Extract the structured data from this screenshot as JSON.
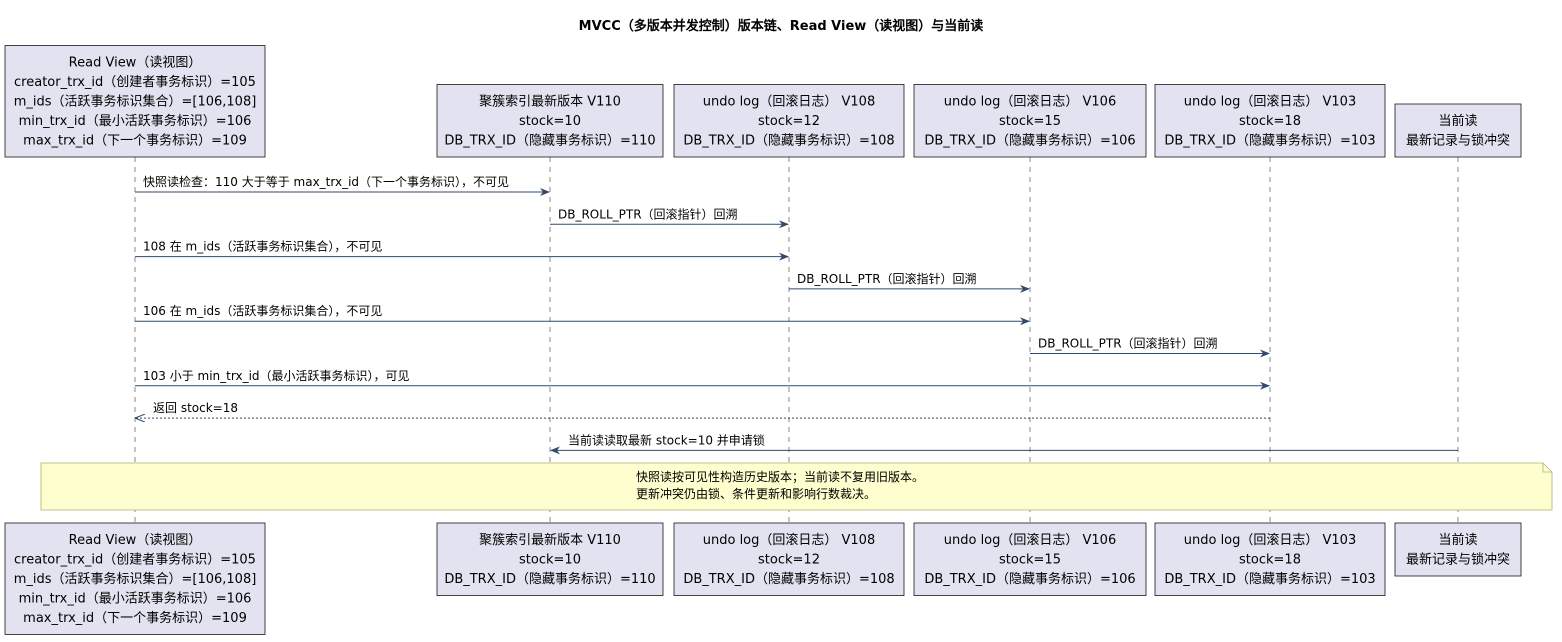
{
  "title": "MVCC（多版本并发控制）版本链、Read View（读视图）与当前读",
  "participants": [
    {
      "id": "rv",
      "lines": [
        "Read View（读视图）",
        "creator_trx_id（创建者事务标识）=105",
        "m_ids（活跃事务标识集合）=[106,108]",
        "min_trx_id（最小活跃事务标识）=106",
        "max_trx_id（下一个事务标识）=109"
      ]
    },
    {
      "id": "v110",
      "lines": [
        "聚簇索引最新版本 V110",
        "stock=10",
        "DB_TRX_ID（隐藏事务标识）=110"
      ]
    },
    {
      "id": "v108",
      "lines": [
        "undo log（回滚日志） V108",
        "stock=12",
        "DB_TRX_ID（隐藏事务标识）=108"
      ]
    },
    {
      "id": "v106",
      "lines": [
        "undo log（回滚日志） V106",
        "stock=15",
        "DB_TRX_ID（隐藏事务标识）=106"
      ]
    },
    {
      "id": "v103",
      "lines": [
        "undo log（回滚日志） V103",
        "stock=18",
        "DB_TRX_ID（隐藏事务标识）=103"
      ]
    },
    {
      "id": "cur",
      "lines": [
        "当前读",
        "最新记录与锁冲突"
      ]
    }
  ],
  "messages": [
    {
      "from": "rv",
      "to": "v110",
      "label": "快照读检查：110 大于等于 max_trx_id（下一个事务标识），不可见",
      "style": "solid"
    },
    {
      "from": "v110",
      "to": "v108",
      "label": "DB_ROLL_PTR（回滚指针）回溯",
      "style": "solid"
    },
    {
      "from": "rv",
      "to": "v108",
      "label": "108 在 m_ids（活跃事务标识集合），不可见",
      "style": "solid"
    },
    {
      "from": "v108",
      "to": "v106",
      "label": "DB_ROLL_PTR（回滚指针）回溯",
      "style": "solid"
    },
    {
      "from": "rv",
      "to": "v106",
      "label": "106 在 m_ids（活跃事务标识集合），不可见",
      "style": "solid"
    },
    {
      "from": "v106",
      "to": "v103",
      "label": "DB_ROLL_PTR（回滚指针）回溯",
      "style": "solid"
    },
    {
      "from": "rv",
      "to": "v103",
      "label": "103 小于 min_trx_id（最小活跃事务标识），可见",
      "style": "solid"
    },
    {
      "from": "v103",
      "to": "rv",
      "label": "返回 stock=18",
      "style": "dashed"
    },
    {
      "from": "cur",
      "to": "v110",
      "label": "当前读读取最新 stock=10 并申请锁",
      "style": "solid"
    }
  ],
  "note": {
    "lines": [
      "快照读按可见性构造历史版本；当前读不复用旧版本。",
      "更新冲突仍由锁、条件更新和影响行数裁决。"
    ]
  },
  "colors": {
    "participant_fill": "#e2e2f0",
    "participant_stroke": "#181818",
    "arrow": "#2f4a6b",
    "lifeline": "#8a8a8a",
    "note_fill": "#fefece",
    "note_stroke": "#b0b07a"
  }
}
